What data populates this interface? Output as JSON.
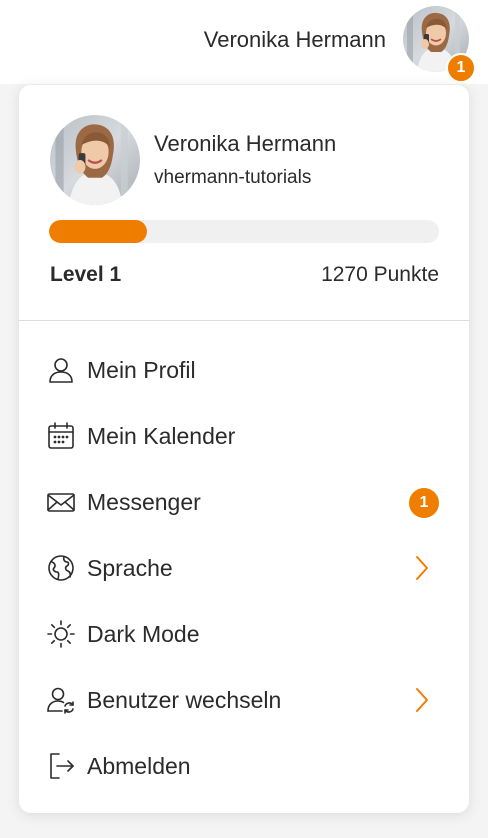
{
  "header": {
    "username": "Veronika Hermann",
    "notification_count": "1"
  },
  "profile": {
    "name": "Veronika Hermann",
    "handle": "vhermann-tutorials",
    "progress_fraction": 0.25,
    "level": "Level 1",
    "points": "1270 Punkte"
  },
  "menu": {
    "items": [
      {
        "label": "Mein Profil",
        "icon": "user-icon"
      },
      {
        "label": "Mein Kalender",
        "icon": "calendar-icon"
      },
      {
        "label": "Messenger",
        "icon": "envelope-icon",
        "badge": "1"
      },
      {
        "label": "Sprache",
        "icon": "globe-icon"
      },
      {
        "label": "Dark Mode",
        "icon": "sun-icon"
      },
      {
        "label": "Benutzer wechseln",
        "icon": "switch-user-icon"
      },
      {
        "label": "Abmelden",
        "icon": "logout-icon"
      }
    ]
  },
  "colors": {
    "accent": "#ef7d00",
    "text": "#2b2b2b",
    "track": "#f0f0f0"
  }
}
